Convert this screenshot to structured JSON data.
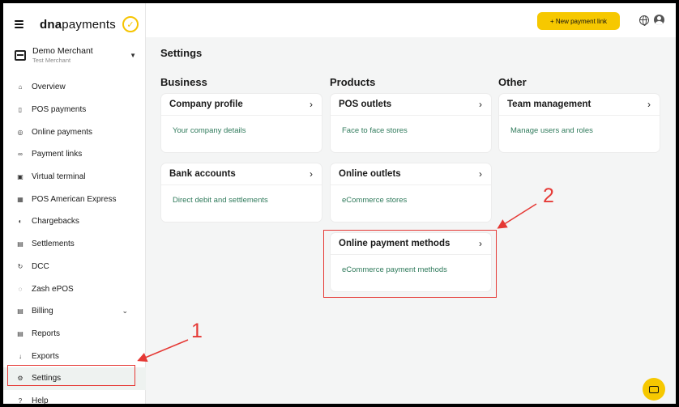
{
  "brand": {
    "logo_bold": "dna",
    "logo_light": "payments"
  },
  "merchant": {
    "name": "Demo Merchant",
    "sub": "Test Merchant"
  },
  "sidebar": {
    "items": [
      {
        "label": "Overview",
        "icon": "⌂"
      },
      {
        "label": "POS payments",
        "icon": "▯"
      },
      {
        "label": "Online payments",
        "icon": "◎"
      },
      {
        "label": "Payment links",
        "icon": "∞"
      },
      {
        "label": "Virtual terminal",
        "icon": "▣"
      },
      {
        "label": "POS American Express",
        "icon": "▦"
      },
      {
        "label": "Chargebacks",
        "icon": "◐"
      },
      {
        "label": "Settlements",
        "icon": "▤"
      },
      {
        "label": "DCC",
        "icon": "↻"
      },
      {
        "label": "Zash ePOS",
        "icon": "◌"
      },
      {
        "label": "Billing",
        "icon": "▤",
        "chevron": "⌄"
      },
      {
        "label": "Reports",
        "icon": "▤"
      },
      {
        "label": "Exports",
        "icon": "↓"
      },
      {
        "label": "Settings",
        "icon": "⚙"
      },
      {
        "label": "Help",
        "icon": "?"
      }
    ]
  },
  "topbar": {
    "new_link_label": "+ New payment link"
  },
  "main": {
    "title": "Settings",
    "columns": [
      {
        "title": "Business"
      },
      {
        "title": "Products"
      },
      {
        "title": "Other"
      }
    ],
    "cards": {
      "company_profile": {
        "title": "Company profile",
        "desc": "Your company details"
      },
      "bank_accounts": {
        "title": "Bank accounts",
        "desc": "Direct debit and settlements"
      },
      "pos_outlets": {
        "title": "POS outlets",
        "desc": "Face to face stores"
      },
      "online_outlets": {
        "title": "Online outlets",
        "desc": "eCommerce stores"
      },
      "online_payment_methods": {
        "title": "Online payment methods",
        "desc": "eCommerce payment methods"
      },
      "team_management": {
        "title": "Team management",
        "desc": "Manage users and roles"
      }
    }
  },
  "annotations": {
    "one": "1",
    "two": "2"
  },
  "colors": {
    "accent": "#f6c800",
    "link_green": "#2f7a5b",
    "annotation_red": "#e53935"
  }
}
